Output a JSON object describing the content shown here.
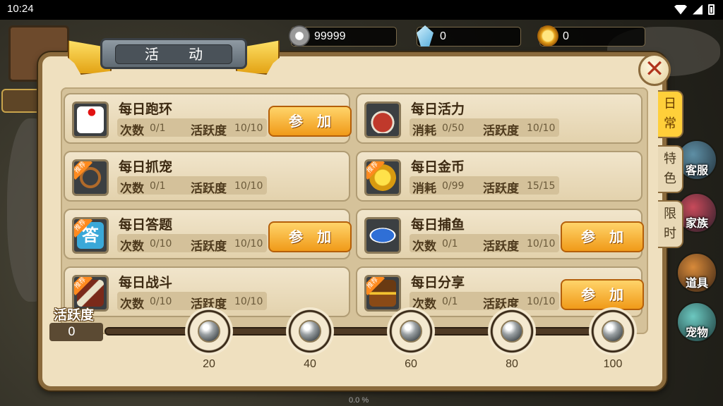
{
  "status_bar": {
    "time": "10:24"
  },
  "scene": {
    "percent": "0.0 %",
    "side_buttons": [
      "客服",
      "家族",
      "道具",
      "宠物"
    ]
  },
  "currency": [
    {
      "icon": "silver-coin-icon",
      "value": "99999"
    },
    {
      "icon": "diamond-icon",
      "value": "0"
    },
    {
      "icon": "gold-ingot-icon",
      "value": "0"
    }
  ],
  "panel": {
    "title": "活 动",
    "close_icon": "close-icon"
  },
  "tabs": [
    {
      "label": "日常",
      "active": true
    },
    {
      "label": "特色",
      "active": false
    },
    {
      "label": "限时",
      "active": false
    }
  ],
  "activities": [
    {
      "title": "每日跑环",
      "label1": "次数",
      "value1": "0/1",
      "label2": "活跃度",
      "value2": "10/10",
      "icon": "running-man-icon",
      "recommended": false,
      "button": "参加"
    },
    {
      "title": "每日活力",
      "label1": "消耗",
      "value1": "0/50",
      "label2": "活跃度",
      "value2": "10/10",
      "icon": "meat-icon",
      "recommended": false,
      "button": ""
    },
    {
      "title": "每日抓宠",
      "label1": "次数",
      "value1": "0/1",
      "label2": "活跃度",
      "value2": "10/10",
      "icon": "rope-icon",
      "recommended": true,
      "button": ""
    },
    {
      "title": "每日金币",
      "label1": "消耗",
      "value1": "0/99",
      "label2": "活跃度",
      "value2": "15/15",
      "icon": "gold-coin-icon",
      "recommended": true,
      "button": ""
    },
    {
      "title": "每日答题",
      "label1": "次数",
      "value1": "0/10",
      "label2": "活跃度",
      "value2": "10/10",
      "icon": "answer-icon",
      "recommended": true,
      "button": "参加",
      "icon_text": "答"
    },
    {
      "title": "每日捕鱼",
      "label1": "次数",
      "value1": "0/1",
      "label2": "活跃度",
      "value2": "10/10",
      "icon": "fish-icon",
      "recommended": false,
      "button": "参加"
    },
    {
      "title": "每日战斗",
      "label1": "次数",
      "value1": "0/10",
      "label2": "活跃度",
      "value2": "10/10",
      "icon": "sword-icon",
      "recommended": true,
      "button": ""
    },
    {
      "title": "每日分享",
      "label1": "次数",
      "value1": "0/1",
      "label2": "活跃度",
      "value2": "10/10",
      "icon": "treasure-icon",
      "recommended": true,
      "button": "参加"
    }
  ],
  "recommend_tag": "推荐",
  "progress": {
    "label": "活跃度",
    "value": "0",
    "fill_fraction": 0,
    "milestones": [
      "20",
      "40",
      "60",
      "80",
      "100"
    ],
    "reward_icon": "pearl-shell-icon"
  },
  "colors": {
    "accent": "#f09a19",
    "panel": "#efe0bf",
    "tab_active": "#ffcf3a"
  }
}
